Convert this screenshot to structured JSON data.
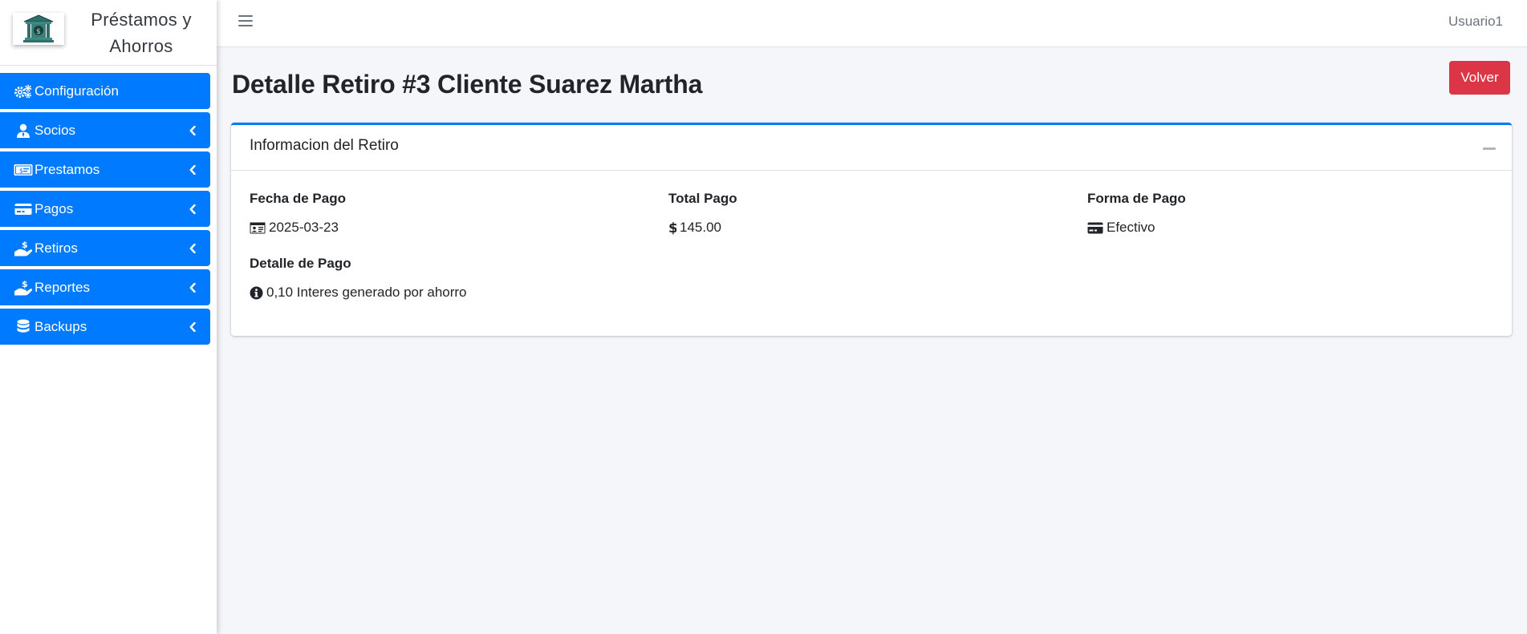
{
  "app": {
    "brand_line1": "Préstamos y",
    "brand_line2": "Ahorros",
    "user": "Usuario1"
  },
  "sidebar": {
    "items": [
      {
        "label": "Configuración",
        "icon": "cogs-icon",
        "has_chevron": false
      },
      {
        "label": "Socios",
        "icon": "user-tie-icon",
        "has_chevron": true
      },
      {
        "label": "Prestamos",
        "icon": "money-bill-icon",
        "has_chevron": true
      },
      {
        "label": "Pagos",
        "icon": "credit-card-icon",
        "has_chevron": true
      },
      {
        "label": "Retiros",
        "icon": "hand-holding-usd-icon",
        "has_chevron": true
      },
      {
        "label": "Reportes",
        "icon": "hand-holding-usd-icon",
        "has_chevron": true
      },
      {
        "label": "Backups",
        "icon": "database-icon",
        "has_chevron": true
      }
    ]
  },
  "page": {
    "title": "Detalle Retiro #3 Cliente Suarez Martha",
    "back_button": "Volver"
  },
  "card": {
    "title": "Informacion del Retiro",
    "fields": {
      "fecha": {
        "label": "Fecha de Pago",
        "value": "2025-03-23"
      },
      "total": {
        "label": "Total Pago",
        "value": "145.00"
      },
      "forma": {
        "label": "Forma de Pago",
        "value": "Efectivo"
      },
      "detalle": {
        "label": "Detalle de Pago",
        "value": "0,10 Interes generado por ahorro"
      }
    }
  },
  "colors": {
    "primary": "#007bff",
    "danger": "#dc3545",
    "background": "#f4f6f9"
  }
}
